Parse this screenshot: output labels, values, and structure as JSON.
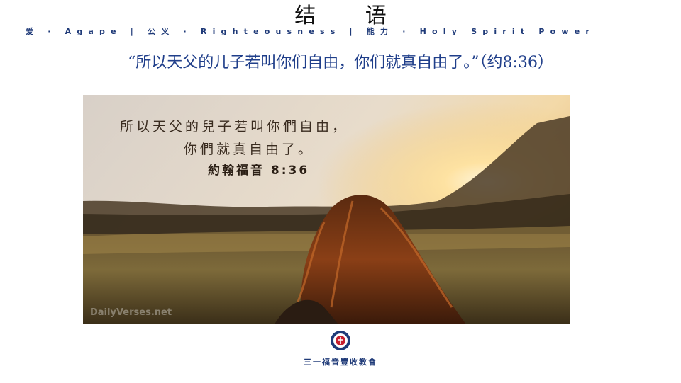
{
  "slide": {
    "title": "结 语",
    "motto": "爱 · Agape | 公义 · Righteousness | 能力 · Holy Spirit Power",
    "verse": "“所以天父的儿子若叫你们自由，你们就真自由了。”（约8:36）"
  },
  "photo": {
    "line1": "所以天父的兒子若叫你們自由，",
    "line2": "你們就真自由了。",
    "reference": "約翰福音 8:36",
    "watermark": "DailyVerses.net"
  },
  "footer": {
    "church_name": "三一福音豐收教會"
  },
  "colors": {
    "accent_blue": "#1f3a78",
    "verse_blue": "#1f3e8a",
    "logo_red": "#c8202e"
  }
}
